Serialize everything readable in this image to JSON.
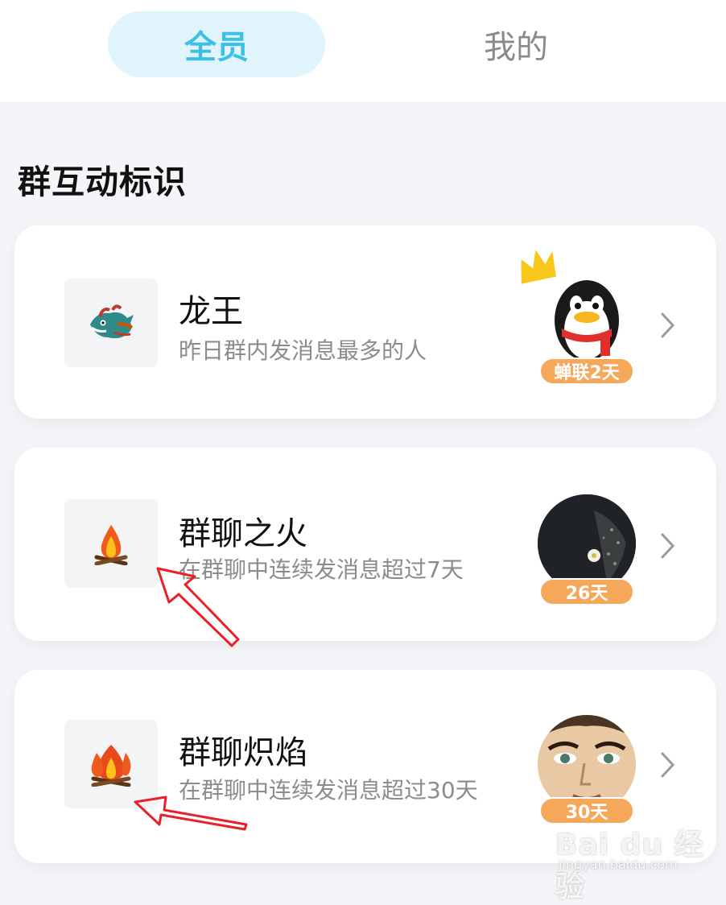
{
  "tabs": {
    "all_label": "全员",
    "mine_label": "我的"
  },
  "section": {
    "title": "群互动标识"
  },
  "cards": [
    {
      "icon": "dragon-icon",
      "title": "龙王",
      "desc": "昨日群内发消息最多的人",
      "badge": "蝉联2天",
      "avatar": "penguin-avatar",
      "decoration": "crown-icon"
    },
    {
      "icon": "campfire-icon",
      "title": "群聊之火",
      "desc": "在群聊中连续发消息超过7天",
      "badge": "26天",
      "avatar": "night-flower-avatar"
    },
    {
      "icon": "blazing-fire-icon",
      "title": "群聊炽焰",
      "desc": "在群聊中连续发消息超过30天",
      "badge": "30天",
      "avatar": "face-avatar"
    }
  ],
  "watermark": {
    "brand": "Bai du 经验",
    "url": "jingyan.baidu.com"
  },
  "colors": {
    "accent": "#3ebfe8",
    "tab_active_bg": "#e0f4fb",
    "badge": "#f5a85a",
    "annotation_arrow": "#e8202a"
  }
}
